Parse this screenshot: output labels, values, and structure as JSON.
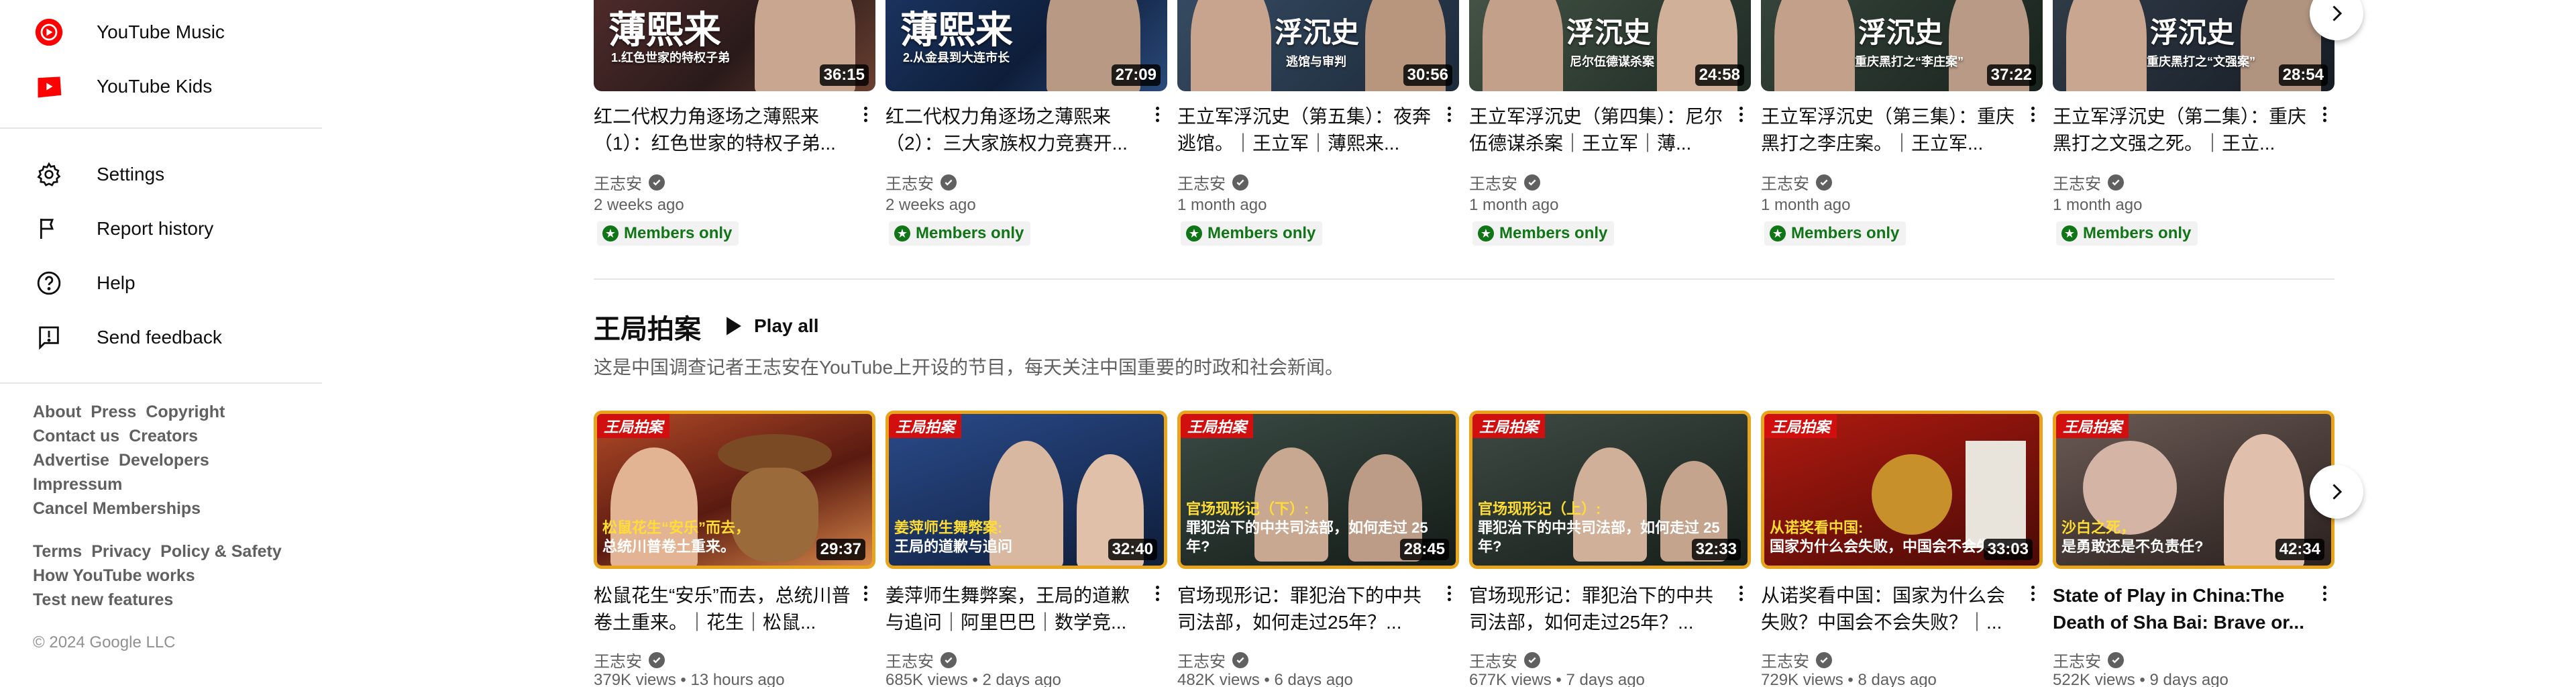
{
  "sidebar": {
    "top_items": [
      {
        "label": "YouTube Music",
        "icon": "youtube-music-icon"
      },
      {
        "label": "YouTube Kids",
        "icon": "youtube-kids-icon"
      }
    ],
    "mid_items": [
      {
        "label": "Settings",
        "icon": "gear-icon"
      },
      {
        "label": "Report history",
        "icon": "flag-icon"
      },
      {
        "label": "Help",
        "icon": "help-icon"
      },
      {
        "label": "Send feedback",
        "icon": "feedback-icon"
      }
    ],
    "footer_rows": [
      [
        "About",
        "Press",
        "Copyright"
      ],
      [
        "Contact us",
        "Creators"
      ],
      [
        "Advertise",
        "Developers"
      ],
      [
        "Impressum"
      ],
      [
        "Cancel Memberships"
      ],
      [
        "Terms",
        "Privacy",
        "Policy & Safety"
      ],
      [
        "How YouTube works"
      ],
      [
        "Test new features"
      ]
    ],
    "copyright": "© 2024 Google LLC"
  },
  "row1": {
    "videos": [
      {
        "title": "红二代权力角逐场之薄熙来（1）：红色世家的特权子弟...",
        "channel": "王志安",
        "age": "2 weeks ago",
        "badge": "Members only",
        "duration": "36:15",
        "thumb_text": "薄熙来",
        "thumb_sub": "1.红色世家的特权子弟",
        "theme": "#4a2a2a"
      },
      {
        "title": "红二代权力角逐场之薄熙来（2）：三大家族权力竞赛开...",
        "channel": "王志安",
        "age": "2 weeks ago",
        "badge": "Members only",
        "duration": "27:09",
        "thumb_text": "薄熙来",
        "thumb_sub": "2.从金县到大连市长",
        "theme": "#1e3a6a"
      },
      {
        "title": "王立军浮沉史（第五集）：夜奔逃馆。｜王立军｜薄熙来...",
        "channel": "王志安",
        "age": "1 month ago",
        "badge": "Members only",
        "duration": "30:56",
        "thumb_text": "浮沉史",
        "thumb_sub": "逃馆与审判",
        "theme": "#2a3f55"
      },
      {
        "title": "王立军浮沉史（第四集）：尼尔伍德谋杀案｜王立军｜薄...",
        "channel": "王志安",
        "age": "1 month ago",
        "badge": "Members only",
        "duration": "24:58",
        "thumb_text": "浮沉史",
        "thumb_sub": "尼尔伍德谋杀案",
        "theme": "#3a4a3a"
      },
      {
        "title": "王立军浮沉史（第三集）：重庆黑打之李庄案。｜王立军...",
        "channel": "王志安",
        "age": "1 month ago",
        "badge": "Members only",
        "duration": "37:22",
        "thumb_text": "浮沉史",
        "thumb_sub": "重庆黑打之“李庄案”",
        "theme": "#34423a"
      },
      {
        "title": "王立军浮沉史（第二集）：重庆黑打之文强之死。｜王立...",
        "channel": "王志安",
        "age": "1 month ago",
        "badge": "Members only",
        "duration": "28:54",
        "thumb_text": "浮沉史",
        "thumb_sub": "重庆黑打之“文强案”",
        "theme": "#2c3440"
      }
    ]
  },
  "shelf": {
    "title": "王局拍案",
    "play_all": "Play all",
    "description": "这是中国调查记者王志安在YouTube上开设的节目，每天关注中国重要的时政和社会新闻。",
    "videos": [
      {
        "title": "松鼠花生“安乐”而去，总统川普卷土重来。｜花生｜松鼠...",
        "channel": "王志安",
        "meta": "379K views • 13 hours ago",
        "duration": "29:37",
        "ribbon": "王局拍案",
        "cap_yellow": "松鼠花生“安乐”而去，",
        "cap_white": "总统川普卷土重来。",
        "theme": "#8a3a22",
        "border": "#e8a41a"
      },
      {
        "title": "姜萍师生舞弊案，王局的道歉与追问｜阿里巴巴｜数学竞...",
        "channel": "王志安",
        "meta": "685K views • 2 days ago",
        "duration": "32:40",
        "ribbon": "王局拍案",
        "cap_yellow": "姜萍师生舞弊案:",
        "cap_white": "王局的道歉与追问",
        "theme": "#1c3f7a",
        "border": "#e8a41a"
      },
      {
        "title": "官场现形记：罪犯治下的中共司法部，如何走过25年？...",
        "channel": "王志安",
        "meta": "482K views • 6 days ago",
        "duration": "28:45",
        "ribbon": "王局拍案",
        "cap_yellow": "官场现形记（下）:",
        "cap_white": "罪犯治下的中共司法部，如何走过 25 年?",
        "theme": "#23302a",
        "border": "#e8a41a"
      },
      {
        "title": "官场现形记：罪犯治下的中共司法部，如何走过25年？...",
        "channel": "王志安",
        "meta": "677K views • 7 days ago",
        "duration": "32:33",
        "ribbon": "王局拍案",
        "cap_yellow": "官场现形记（上）:",
        "cap_white": "罪犯治下的中共司法部，如何走过 25 年?",
        "theme": "#2d3530",
        "border": "#e8a41a"
      },
      {
        "title": "从诺奖看中国：国家为什么会失败？中国会不会失败？｜...",
        "channel": "王志安",
        "meta": "729K views • 8 days ago",
        "duration": "33:03",
        "ribbon": "王局拍案",
        "cap_yellow": "从诺奖看中国:",
        "cap_white": "国家为什么会失败，中国会不会失败?",
        "theme": "#7a1a10",
        "border": "#e8a41a"
      },
      {
        "title": "State of Play in China:The Death of Sha Bai: Brave or...",
        "channel": "王志安",
        "meta": "522K views • 9 days ago",
        "duration": "42:34",
        "ribbon": "王局拍案",
        "cap_yellow": "沙白之死，",
        "cap_white": "是勇敢还是不负责任?",
        "theme": "#4a3a36",
        "border": "#e8a41a"
      }
    ]
  },
  "colors": {
    "members_green": "#107516",
    "ribbon_red": "#d10f0f",
    "yt_red": "#ff0000"
  }
}
